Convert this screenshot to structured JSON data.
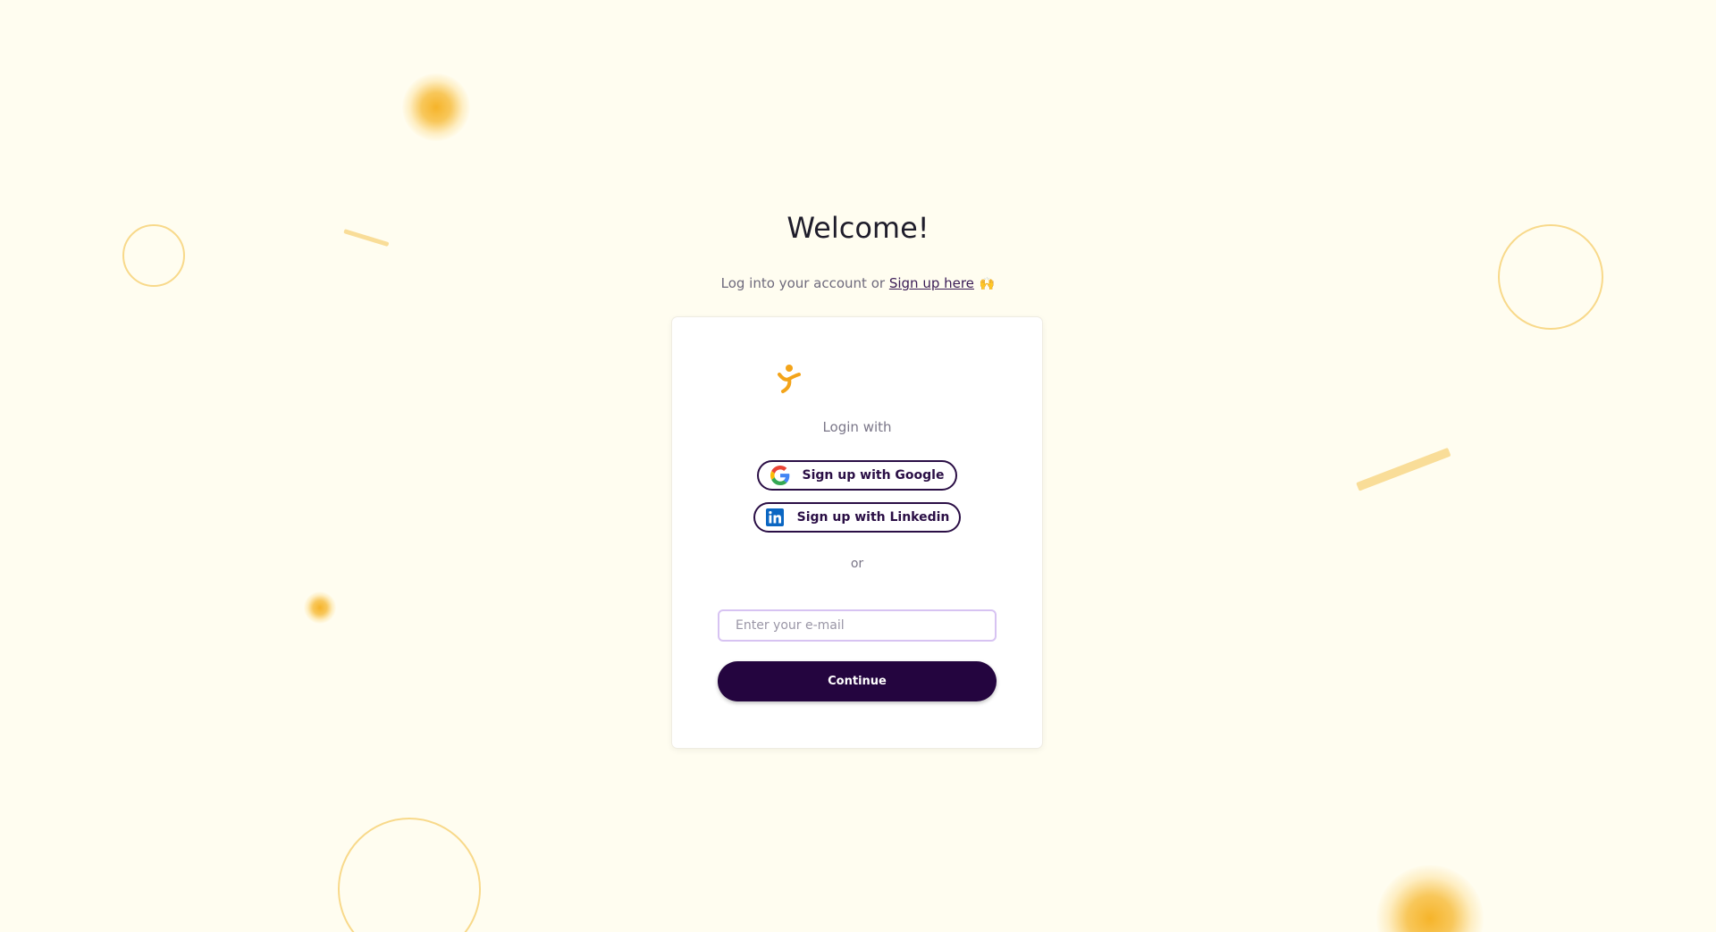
{
  "page": {
    "title": "Welcome!",
    "subtitle_prefix": "Log into your account or ",
    "signup_link": "Sign up here",
    "emoji": "🙌"
  },
  "card": {
    "logo_icon": "brand-figure-icon",
    "login_with": "Login with",
    "google_button": "Sign up with Google",
    "google_icon": "google-icon",
    "linkedin_button": "Sign up with Linkedin",
    "linkedin_icon": "linkedin-icon",
    "or_label": "or",
    "email_placeholder": "Enter your e-mail",
    "email_value": "",
    "continue_button": "Continue"
  },
  "colors": {
    "background": "#fffdf0",
    "primary": "#24053f",
    "accent": "#f3a41a",
    "decoration": "#f8d98a"
  }
}
